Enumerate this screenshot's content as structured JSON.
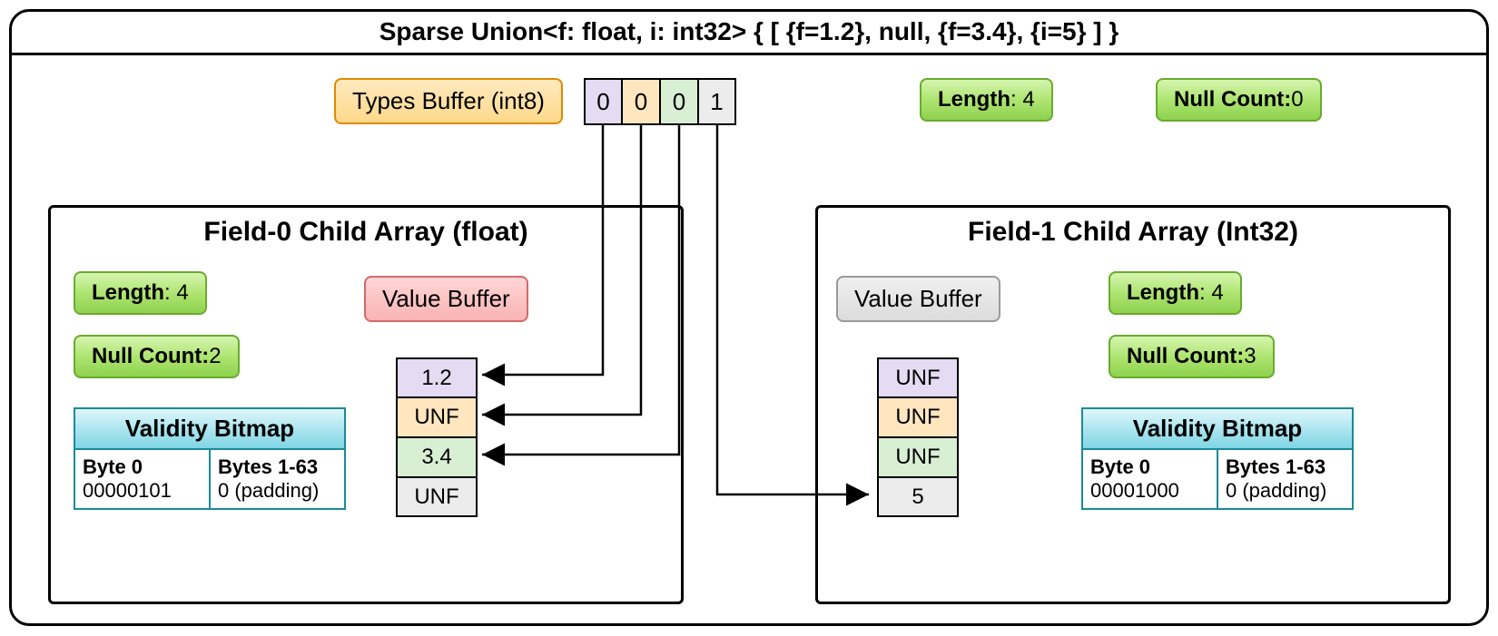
{
  "title": "Sparse Union<f: float, i: int32> { [ {f=1.2}, null, {f=3.4}, {i=5} ] }",
  "union": {
    "types_label": "Types Buffer (int8)",
    "types": [
      "0",
      "0",
      "0",
      "1"
    ],
    "length_label": "Length",
    "length_value": ": 4",
    "nullcount_label": "Null Count:",
    "nullcount_value": " 0"
  },
  "child0": {
    "title": "Field-0 Child Array (float)",
    "length_label": "Length",
    "length_value": ": 4",
    "nullcount_label": "Null Count:",
    "nullcount_value": " 2",
    "value_buffer_label": "Value Buffer",
    "values": [
      "1.2",
      "UNF",
      "3.4",
      "UNF"
    ],
    "vb_title": "Validity Bitmap",
    "vb_col0_h": "Byte 0",
    "vb_col0_v": "00000101",
    "vb_col1_h": "Bytes 1-63",
    "vb_col1_v": "0 (padding)"
  },
  "child1": {
    "title": "Field-1 Child Array (Int32)",
    "length_label": "Length",
    "length_value": ": 4",
    "nullcount_label": "Null Count:",
    "nullcount_value": " 3",
    "value_buffer_label": "Value Buffer",
    "values": [
      "UNF",
      "UNF",
      "UNF",
      "5"
    ],
    "vb_title": "Validity Bitmap",
    "vb_col0_h": "Byte 0",
    "vb_col0_v": "00001000",
    "vb_col1_h": "Bytes 1-63",
    "vb_col1_v": "0 (padding)"
  },
  "colors": [
    "c-purple",
    "c-orange",
    "c-green2",
    "c-gray"
  ]
}
